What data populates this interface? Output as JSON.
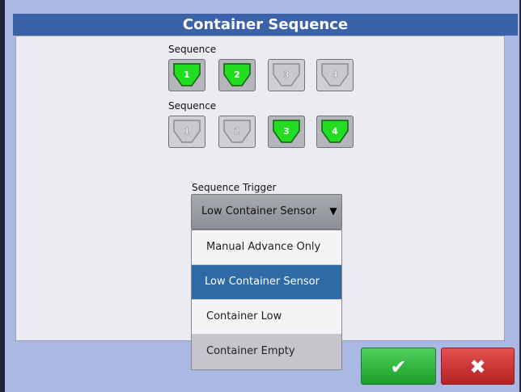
{
  "window": {
    "title": "Container Sequence"
  },
  "sequence1": {
    "label": "Sequence",
    "buttons": [
      {
        "number": "1",
        "active": true
      },
      {
        "number": "2",
        "active": true
      },
      {
        "number": "3",
        "active": false
      },
      {
        "number": "4",
        "active": false
      }
    ]
  },
  "sequence2": {
    "label": "Sequence",
    "buttons": [
      {
        "number": "1",
        "active": false
      },
      {
        "number": "2",
        "active": false
      },
      {
        "number": "3",
        "active": true
      },
      {
        "number": "4",
        "active": true
      }
    ]
  },
  "trigger": {
    "label": "Sequence Trigger",
    "selected": "Low Container Sensor",
    "arrow_icon": "triangle-down-icon",
    "options": [
      "Manual Advance Only",
      "Low Container Sensor",
      "Container Low",
      "Container Empty"
    ]
  },
  "actions": {
    "ok_icon": "checkmark-icon",
    "cancel_icon": "x-icon",
    "ok_glyph": "✔",
    "cancel_glyph": "✖"
  },
  "colors": {
    "title_bar": "#3b62a8",
    "active_container": "#22dd22",
    "inactive_container": "#c8c9cf",
    "selected_option": "#2e6aa5",
    "ok_button": "#27b235",
    "cancel_button": "#cc2f2f"
  }
}
